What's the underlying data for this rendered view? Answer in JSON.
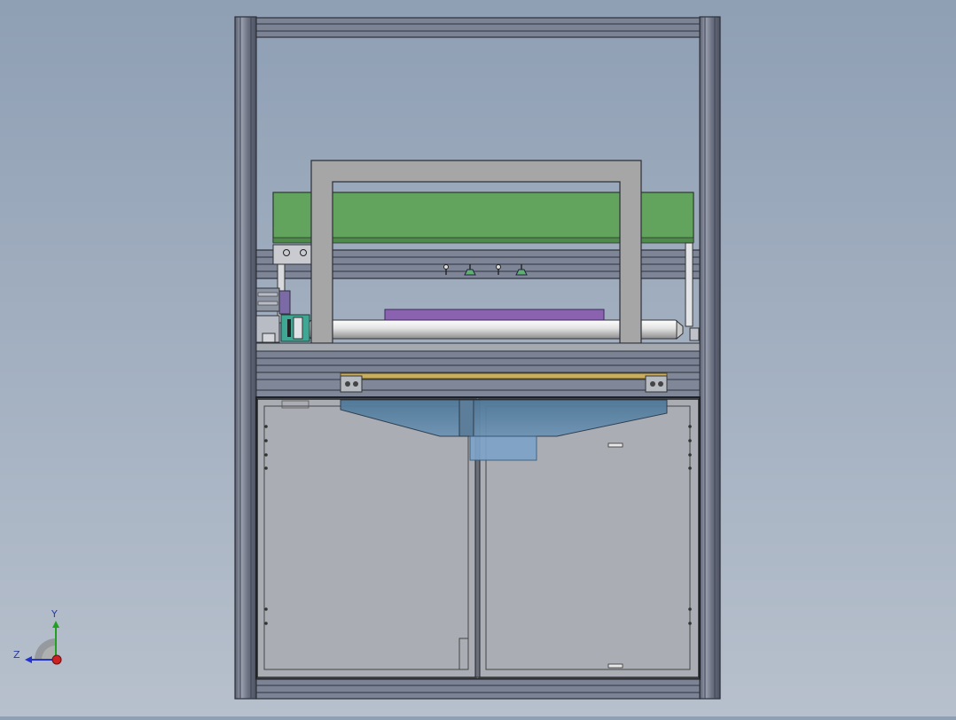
{
  "viewport": {
    "background_top": "#8f9fb4",
    "background_bottom": "#b7c0cc"
  },
  "model": {
    "frame_color": "#6f7788",
    "panel_color": "#a9adb3",
    "conveyor_color": "#62a35e",
    "gantry_color": "#a6a6a6",
    "workpiece_color": "#8a62b0",
    "hopper_color": "#5f85a5",
    "roller_color": "#e4e4e4"
  },
  "triad": {
    "y_label": "Y",
    "z_label": "Z",
    "y_color": "#22a022",
    "z_color": "#2233cc",
    "x_color": "#cc2222"
  }
}
